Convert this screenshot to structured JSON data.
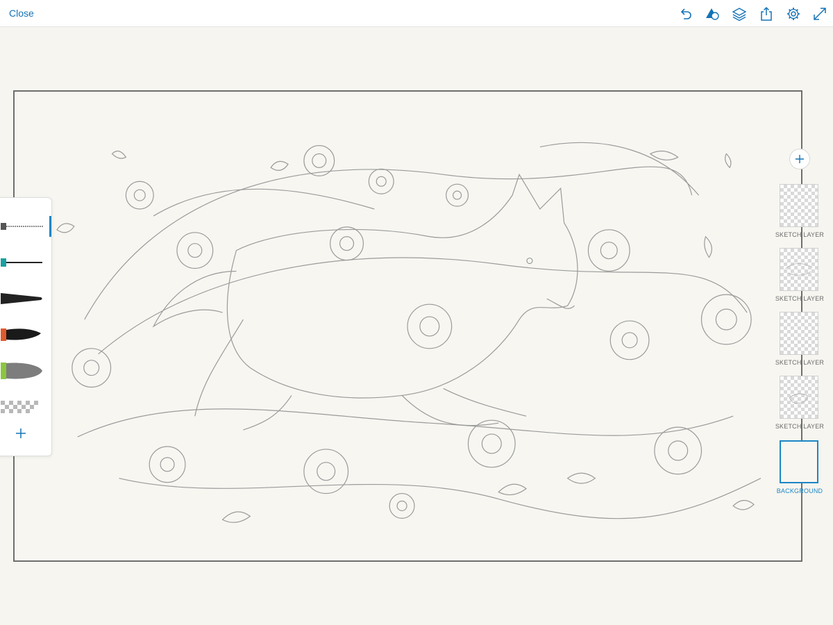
{
  "topbar": {
    "close_label": "Close",
    "icons": [
      "undo-icon",
      "shapes-icon",
      "layers-icon",
      "share-icon",
      "settings-icon",
      "fullscreen-icon"
    ],
    "accent_color": "#1473b6"
  },
  "brushes": {
    "items": [
      {
        "name": "pencil-brush",
        "tip_color": "#555555"
      },
      {
        "name": "ink-pen-brush",
        "tip_color": "#1aa0a0"
      },
      {
        "name": "brush-pen",
        "tip_color": "#222222"
      },
      {
        "name": "paint-brush",
        "tip_color": "#e05a2b"
      },
      {
        "name": "watercolor-brush",
        "tip_color": "#8cc63f"
      },
      {
        "name": "eraser-brush",
        "tip_color": "#aaaaaa"
      }
    ],
    "active_index": 0,
    "add_icon": "plus-icon"
  },
  "layers": {
    "add_icon": "plus-icon",
    "items": [
      {
        "label": "SKETCH LAYER",
        "active": false
      },
      {
        "label": "SKETCH LAYER",
        "active": false
      },
      {
        "label": "SKETCH LAYER",
        "active": false
      },
      {
        "label": "SKETCH LAYER",
        "active": false
      },
      {
        "label": "BACKGROUND",
        "active": true
      }
    ],
    "active_color": "#1b86c5"
  },
  "canvas": {
    "artwork": "pencil-sketch"
  }
}
